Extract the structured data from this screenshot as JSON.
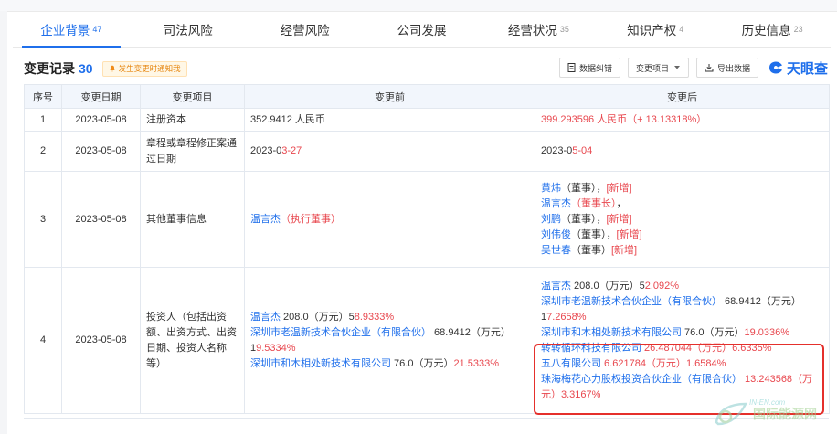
{
  "tabs": [
    {
      "label": "企业背景",
      "count": "47"
    },
    {
      "label": "司法风险",
      "count": ""
    },
    {
      "label": "经营风险",
      "count": ""
    },
    {
      "label": "公司发展",
      "count": ""
    },
    {
      "label": "经营状况",
      "count": "35"
    },
    {
      "label": "知识产权",
      "count": "4"
    },
    {
      "label": "历史信息",
      "count": "23"
    }
  ],
  "section": {
    "title": "变更记录",
    "count": "30",
    "notify": "发生变更时通知我",
    "tool_correct": "数据纠错",
    "tool_filter": "变更项目",
    "tool_export": "导出数据",
    "logo_text": "天眼查"
  },
  "columns": [
    "序号",
    "变更日期",
    "变更项目",
    "变更前",
    "变更后"
  ],
  "rows": [
    {
      "no": "1",
      "date": "2023-05-08",
      "item": "注册资本",
      "before": "352.9412 人民币",
      "after": "399.293596 人民币（+ 13.13318%）"
    },
    {
      "no": "2",
      "date": "2023-05-08",
      "item": "章程或章程修正案通过日期",
      "before_a": "2023-0",
      "before_b": "3-27",
      "after_a": "2023-0",
      "after_b": "5-04"
    },
    {
      "no": "3",
      "date": "2023-05-08",
      "item": "其他董事信息",
      "before_name": "温言杰",
      "before_role": "（执行董事）",
      "after": [
        {
          "name": "黄炜",
          "role": "（董事）",
          "tag": "[新增]",
          "sep": "，"
        },
        {
          "name": "温言杰",
          "role": "（董事长）",
          "tag": "",
          "sep": "，"
        },
        {
          "name": "刘鹏",
          "role": "（董事）",
          "tag": "[新增]",
          "sep": "，"
        },
        {
          "name": "刘伟俊",
          "role": "（董事）",
          "tag": "[新增]",
          "sep": "，"
        },
        {
          "name": "吴世春",
          "role": "（董事）",
          "tag": "[新增]",
          "sep": ""
        }
      ]
    },
    {
      "no": "4",
      "date": "2023-05-08",
      "item": "投资人（包括出资额、出资方式、出资日期、投资人名称等）",
      "before": [
        {
          "name": "温言杰",
          "amt": " 208.0（万元）",
          "pa": "5",
          "pb": "8.9333%"
        },
        {
          "name": "深圳市老温新技术合伙企业（有限合伙）",
          "amt": " 68.9412（万元）",
          "pa": "1",
          "pb": "9.5334%"
        },
        {
          "name": "深圳市和木相处新技术有限公司",
          "amt": " 76.0（万元）",
          "pa": "",
          "pb": "21.5333%"
        }
      ],
      "after": [
        {
          "name": "温言杰",
          "amt": " 208.0（万元）",
          "pa": "5",
          "pb": "2.092%"
        },
        {
          "name": "深圳市老温新技术合伙企业（有限合伙）",
          "amt": " 68.9412（万元）",
          "pa": "1",
          "pb": "7.2658%"
        },
        {
          "name": "深圳市和木相处新技术有限公司",
          "amt": " 76.0（万元）",
          "pa": "",
          "pb": "19.0336%"
        },
        {
          "name": "转转循环科技有限公司",
          "amt": " 26.487044（万元）",
          "pa": "",
          "pb": "6.6335%"
        },
        {
          "name": "五八有限公司",
          "amt": " 6.621784（万元）",
          "pa": "",
          "pb": "1.6584%"
        },
        {
          "name": "珠海梅花心力股权投资合伙企业（有限合伙）",
          "amt": " 13.243568（万元）",
          "pa": "",
          "pb": "3.3167%"
        }
      ]
    }
  ],
  "watermark": {
    "top": "IN-EN.com",
    "text": "国际能源网"
  },
  "colors": {
    "accent": "#1f6feb",
    "red": "#e8474e",
    "highlight": "#e5302c"
  }
}
